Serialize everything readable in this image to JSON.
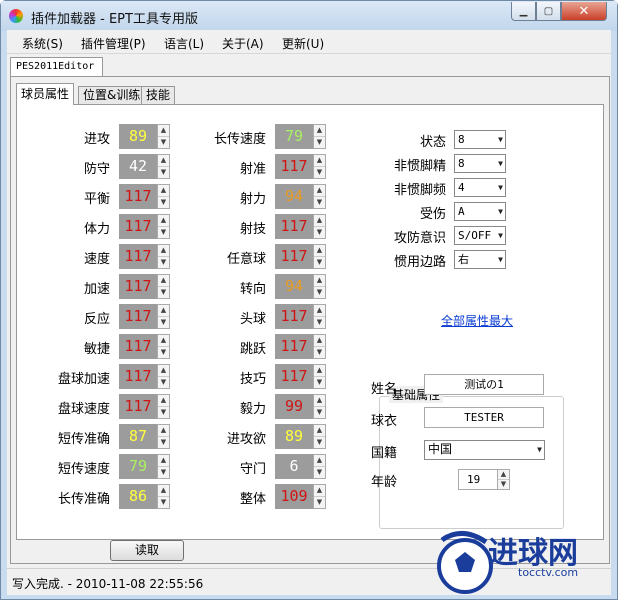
{
  "window": {
    "title": "插件加载器 - EPT工具专用版"
  },
  "menu": [
    "系统(S)",
    "插件管理(P)",
    "语言(L)",
    "关于(A)",
    "更新(U)"
  ],
  "outer_tab": "PES2011Editor",
  "tabs": [
    "球员属性",
    "位置&训练",
    "技能"
  ],
  "left_stats": [
    {
      "label": "进攻",
      "value": "89",
      "color": "yellow"
    },
    {
      "label": "防守",
      "value": "42",
      "color": "white"
    },
    {
      "label": "平衡",
      "value": "117",
      "color": "red"
    },
    {
      "label": "体力",
      "value": "117",
      "color": "red"
    },
    {
      "label": "速度",
      "value": "117",
      "color": "red"
    },
    {
      "label": "加速",
      "value": "117",
      "color": "red"
    },
    {
      "label": "反应",
      "value": "117",
      "color": "red"
    },
    {
      "label": "敏捷",
      "value": "117",
      "color": "red"
    },
    {
      "label": "盘球加速",
      "value": "117",
      "color": "red"
    },
    {
      "label": "盘球速度",
      "value": "117",
      "color": "red"
    },
    {
      "label": "短传准确",
      "value": "87",
      "color": "yellow"
    },
    {
      "label": "短传速度",
      "value": "79",
      "color": "green"
    },
    {
      "label": "长传准确",
      "value": "86",
      "color": "yellow"
    }
  ],
  "mid_stats": [
    {
      "label": "长传速度",
      "value": "79",
      "color": "green"
    },
    {
      "label": "射准",
      "value": "117",
      "color": "red"
    },
    {
      "label": "射力",
      "value": "94",
      "color": "orange"
    },
    {
      "label": "射技",
      "value": "117",
      "color": "red"
    },
    {
      "label": "任意球",
      "value": "117",
      "color": "red"
    },
    {
      "label": "转向",
      "value": "94",
      "color": "orange"
    },
    {
      "label": "头球",
      "value": "117",
      "color": "red"
    },
    {
      "label": "跳跃",
      "value": "117",
      "color": "red"
    },
    {
      "label": "技巧",
      "value": "117",
      "color": "red"
    },
    {
      "label": "毅力",
      "value": "99",
      "color": "red"
    },
    {
      "label": "进攻欲",
      "value": "89",
      "color": "yellow"
    },
    {
      "label": "守门",
      "value": "6",
      "color": "white"
    },
    {
      "label": "整体",
      "value": "109",
      "color": "red"
    }
  ],
  "right_props": [
    {
      "label": "状态",
      "value": "8"
    },
    {
      "label": "非惯脚精",
      "value": "8"
    },
    {
      "label": "非惯脚频",
      "value": "4"
    },
    {
      "label": "受伤",
      "value": "A"
    },
    {
      "label": "攻防意识",
      "value": "S/OFF"
    },
    {
      "label": "惯用边路",
      "value": "右"
    }
  ],
  "max_all_link": "全部属性最大",
  "basic": {
    "title": "基础属性",
    "name_label": "姓名",
    "name_value": "测试の1",
    "shirt_label": "球衣",
    "shirt_value": "TESTER",
    "nation_label": "国籍",
    "nation_value": "中国",
    "age_label": "年龄",
    "age_value": "19"
  },
  "read_button": "读取",
  "status": "写入完成. - 2010-11-08 22:55:56",
  "watermark": {
    "text": "进球网",
    "url": "tocctv.com"
  }
}
